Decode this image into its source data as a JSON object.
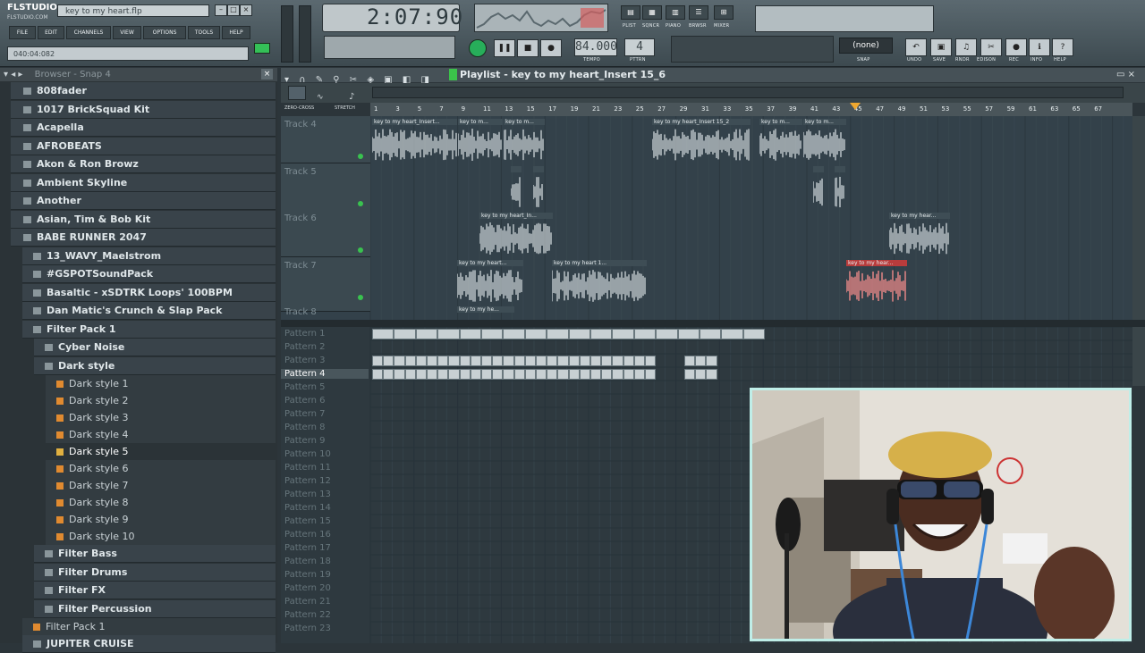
{
  "app": {
    "logo_line1": "FLSTUDIO",
    "logo_line2": "FLSTUDIO.COM",
    "project_file": "key to my heart.flp",
    "hint": "040:04:082",
    "time": "2:07:90",
    "tempo": "84.000",
    "pattern_num": "4",
    "snap_value": "(none)",
    "snap_label": "SNAP",
    "tempo_label": "TEMPO",
    "pttrn_label": "PTTRN"
  },
  "menu": [
    "FILE",
    "EDIT",
    "CHANNELS",
    "VIEW",
    "OPTIONS",
    "TOOLS",
    "HELP"
  ],
  "view_buttons": [
    "PLIST",
    "SQNCR",
    "PIANO",
    "BRWSR",
    "MIXER"
  ],
  "tool_buttons": [
    "UNDO",
    "SAVE",
    "RNDR",
    "EDISON",
    "REC",
    "INFO",
    "HELP"
  ],
  "browser": {
    "title": "Browser - Snap 4",
    "items": [
      {
        "label": "808fader",
        "kind": "folder",
        "indent": 0
      },
      {
        "label": "1017 BrickSquad Kit",
        "kind": "folder",
        "indent": 0
      },
      {
        "label": "Acapella",
        "kind": "folder",
        "indent": 0
      },
      {
        "label": "AFROBEATS",
        "kind": "folder",
        "indent": 0
      },
      {
        "label": "Akon & Ron Browz",
        "kind": "folder",
        "indent": 0
      },
      {
        "label": "Ambient Skyline",
        "kind": "folder",
        "indent": 0
      },
      {
        "label": "Another",
        "kind": "folder",
        "indent": 0
      },
      {
        "label": "Asian, Tim & Bob Kit",
        "kind": "folder",
        "indent": 0
      },
      {
        "label": "BABE RUNNER 2047",
        "kind": "folder",
        "indent": 0
      },
      {
        "label": "13_WAVY_Maelstrom",
        "kind": "folder",
        "indent": 1
      },
      {
        "label": "#GSPOTSoundPack",
        "kind": "folder",
        "indent": 1
      },
      {
        "label": "Basaltic - xSDTRK Loops' 100BPM",
        "kind": "folder",
        "indent": 1
      },
      {
        "label": "Dan Matic's Crunch & Slap Pack",
        "kind": "folder",
        "indent": 1
      },
      {
        "label": "Filter Pack 1",
        "kind": "folder",
        "indent": 1
      },
      {
        "label": "Cyber Noise",
        "kind": "folder",
        "indent": 2
      },
      {
        "label": "Dark style",
        "kind": "folder",
        "indent": 2
      },
      {
        "label": "Dark style 1",
        "kind": "file",
        "indent": 3
      },
      {
        "label": "Dark style 2",
        "kind": "file",
        "indent": 3
      },
      {
        "label": "Dark style 3",
        "kind": "file",
        "indent": 3
      },
      {
        "label": "Dark style 4",
        "kind": "file",
        "indent": 3
      },
      {
        "label": "Dark style 5",
        "kind": "file",
        "indent": 3,
        "selected": true
      },
      {
        "label": "Dark style 6",
        "kind": "file",
        "indent": 3
      },
      {
        "label": "Dark style 7",
        "kind": "file",
        "indent": 3
      },
      {
        "label": "Dark style 8",
        "kind": "file",
        "indent": 3
      },
      {
        "label": "Dark style 9",
        "kind": "file",
        "indent": 3
      },
      {
        "label": "Dark style 10",
        "kind": "file",
        "indent": 3
      },
      {
        "label": "Filter Bass",
        "kind": "folder",
        "indent": 2
      },
      {
        "label": "Filter Drums",
        "kind": "folder",
        "indent": 2
      },
      {
        "label": "Filter FX",
        "kind": "folder",
        "indent": 2
      },
      {
        "label": "Filter Percussion",
        "kind": "folder",
        "indent": 2
      },
      {
        "label": "Filter Pack 1",
        "kind": "file",
        "indent": 1
      },
      {
        "label": "JUPITER CRUISE",
        "kind": "folder",
        "indent": 1
      }
    ]
  },
  "playlist": {
    "title": "Playlist - key to my heart_Insert 15_6",
    "ruler": [
      "1",
      "3",
      "5",
      "7",
      "9",
      "11",
      "13",
      "15",
      "17",
      "19",
      "21",
      "23",
      "25",
      "27",
      "29",
      "31",
      "33",
      "35",
      "37",
      "39",
      "41",
      "43",
      "45",
      "47",
      "49",
      "51",
      "53",
      "55",
      "57",
      "59",
      "61",
      "63",
      "65",
      "67"
    ],
    "tabs": [
      "ZERO-CROSS",
      "STRETCH"
    ],
    "tracks": [
      "Track 4",
      "Track 5",
      "Track 6",
      "Track 7",
      "Track 8"
    ],
    "clips": [
      {
        "label": "key to my heart_Insert...",
        "track": 0,
        "color": "gray"
      },
      {
        "label": "key to m...",
        "track": 0,
        "color": "gray"
      },
      {
        "label": "key to m...",
        "track": 0,
        "color": "gray"
      },
      {
        "label": "key to my heart_Insert 15_2",
        "track": 0,
        "color": "gray"
      },
      {
        "label": "key to m...",
        "track": 0,
        "color": "gray"
      },
      {
        "label": "key to m...",
        "track": 0,
        "color": "gray"
      },
      {
        "label": "",
        "track": 1,
        "color": "gray"
      },
      {
        "label": "",
        "track": 1,
        "color": "gray"
      },
      {
        "label": "",
        "track": 1,
        "color": "gray"
      },
      {
        "label": "",
        "track": 1,
        "color": "gray"
      },
      {
        "label": "key to my heart_In...",
        "track": 2,
        "color": "gray"
      },
      {
        "label": "key to my hear...",
        "track": 2,
        "color": "gray"
      },
      {
        "label": "key to my heart...",
        "track": 3,
        "color": "gray"
      },
      {
        "label": "key to my heart 1...",
        "track": 3,
        "color": "gray"
      },
      {
        "label": "key to my hear...",
        "track": 3,
        "color": "red"
      },
      {
        "label": "key to my he...",
        "track": 4,
        "color": "gray"
      }
    ],
    "patterns": [
      "Pattern 1",
      "Pattern 2",
      "Pattern 3",
      "Pattern 4",
      "Pattern 5",
      "Pattern 6",
      "Pattern 7",
      "Pattern 8",
      "Pattern 9",
      "Pattern 10",
      "Pattern 11",
      "Pattern 12",
      "Pattern 13",
      "Pattern 14",
      "Pattern 15",
      "Pattern 16",
      "Pattern 17",
      "Pattern 18",
      "Pattern 19",
      "Pattern 20",
      "Pattern 21",
      "Pattern 22",
      "Pattern 23"
    ],
    "active_pattern": "Pattern 4"
  }
}
